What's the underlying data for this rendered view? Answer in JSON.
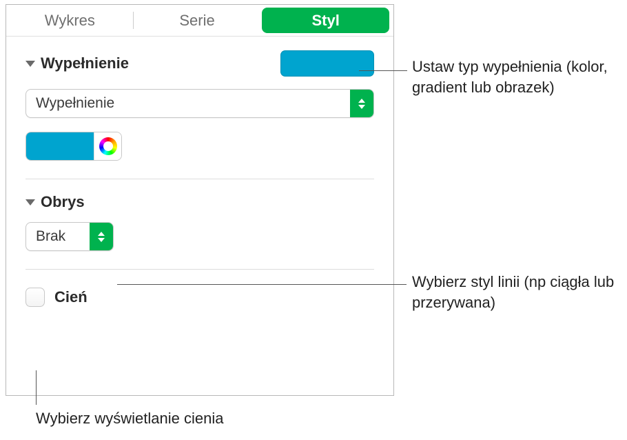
{
  "tabs": {
    "chart": "Wykres",
    "series": "Serie",
    "style": "Styl"
  },
  "fill": {
    "title": "Wypełnienie",
    "dropdown": "Wypełnienie",
    "swatch_color": "#00a4cf"
  },
  "stroke": {
    "title": "Obrys",
    "dropdown": "Brak"
  },
  "shadow": {
    "label": "Cień"
  },
  "callouts": {
    "fill_type": "Ustaw typ wypełnienia (kolor, gradient lub obrazek)",
    "line_style": "Wybierz styl linii (np ciągła lub przerywana)",
    "shadow": "Wybierz wyświetlanie cienia"
  }
}
